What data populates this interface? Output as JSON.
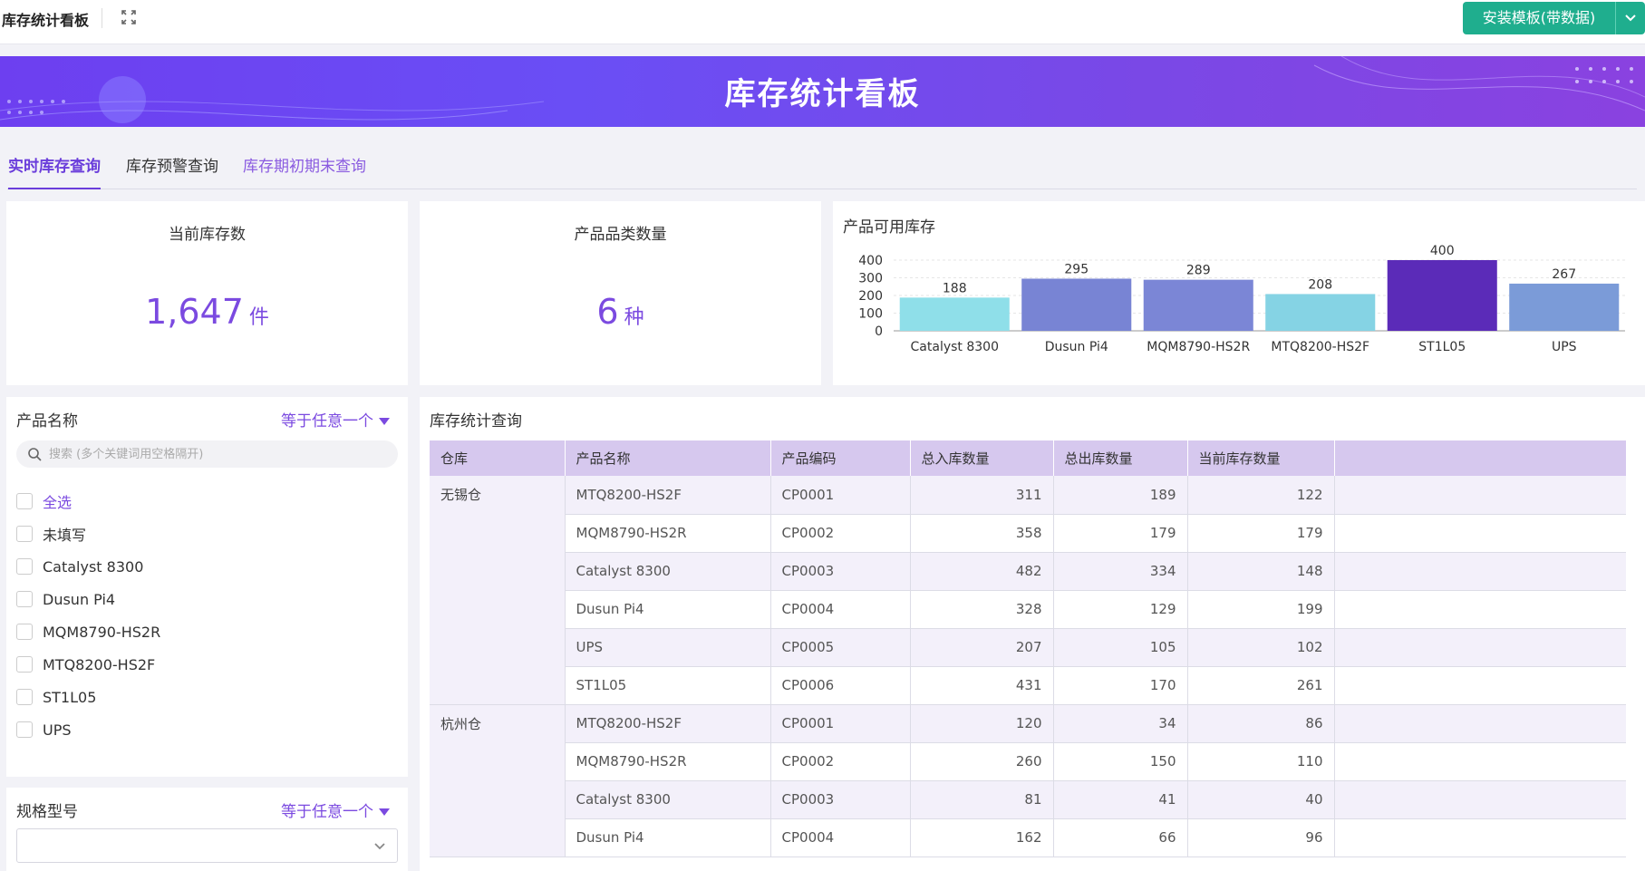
{
  "app": {
    "title": "库存统计看板",
    "install_label": "安装模板(带数据)"
  },
  "banner": {
    "title": "库存统计看板"
  },
  "tabs": [
    {
      "label": "实时库存查询"
    },
    {
      "label": "库存预警查询"
    },
    {
      "label": "库存期初期末查询"
    }
  ],
  "kpis": {
    "stock": {
      "title": "当前库存数",
      "value": "1,647",
      "unit": "件"
    },
    "categories": {
      "title": "产品品类数量",
      "value": "6",
      "unit": "种"
    }
  },
  "chart_data": {
    "type": "bar",
    "title": "产品可用库存",
    "categories": [
      "Catalyst 8300",
      "Dusun Pi4",
      "MQM8790-HS2R",
      "MTQ8200-HS2F",
      "ST1L05",
      "UPS"
    ],
    "values": [
      188,
      295,
      289,
      208,
      400,
      267
    ],
    "colors": [
      "#8fdfe9",
      "#7884d4",
      "#7b86d6",
      "#85d3e4",
      "#5b2bb8",
      "#7b9bd8"
    ],
    "yticks": [
      0,
      100,
      200,
      300,
      400
    ],
    "ylim": [
      0,
      400
    ],
    "grid": true
  },
  "filters": {
    "product": {
      "label": "产品名称",
      "operator": "等于任意一个",
      "search_placeholder": "搜索 (多个关键词用空格隔开)",
      "options": [
        "全选",
        "未填写",
        "Catalyst 8300",
        "Dusun Pi4",
        "MQM8790-HS2R",
        "MTQ8200-HS2F",
        "ST1L05",
        "UPS"
      ]
    },
    "spec": {
      "label": "规格型号",
      "operator": "等于任意一个"
    }
  },
  "table": {
    "title": "库存统计查询",
    "headers": [
      "仓库",
      "产品名称",
      "产品编码",
      "总入库数量",
      "总出库数量",
      "当前库存数量"
    ],
    "groups": [
      {
        "warehouse": "无锡仓",
        "rows": [
          [
            "MTQ8200-HS2F",
            "CP0001",
            "311",
            "189",
            "122"
          ],
          [
            "MQM8790-HS2R",
            "CP0002",
            "358",
            "179",
            "179"
          ],
          [
            "Catalyst 8300",
            "CP0003",
            "482",
            "334",
            "148"
          ],
          [
            "Dusun Pi4",
            "CP0004",
            "328",
            "129",
            "199"
          ],
          [
            "UPS",
            "CP0005",
            "207",
            "105",
            "102"
          ],
          [
            "ST1L05",
            "CP0006",
            "431",
            "170",
            "261"
          ]
        ]
      },
      {
        "warehouse": "杭州仓",
        "rows": [
          [
            "MTQ8200-HS2F",
            "CP0001",
            "120",
            "34",
            "86"
          ],
          [
            "MQM8790-HS2R",
            "CP0002",
            "260",
            "150",
            "110"
          ],
          [
            "Catalyst 8300",
            "CP0003",
            "81",
            "41",
            "40"
          ],
          [
            "Dusun Pi4",
            "CP0004",
            "162",
            "66",
            "96"
          ]
        ]
      }
    ]
  }
}
